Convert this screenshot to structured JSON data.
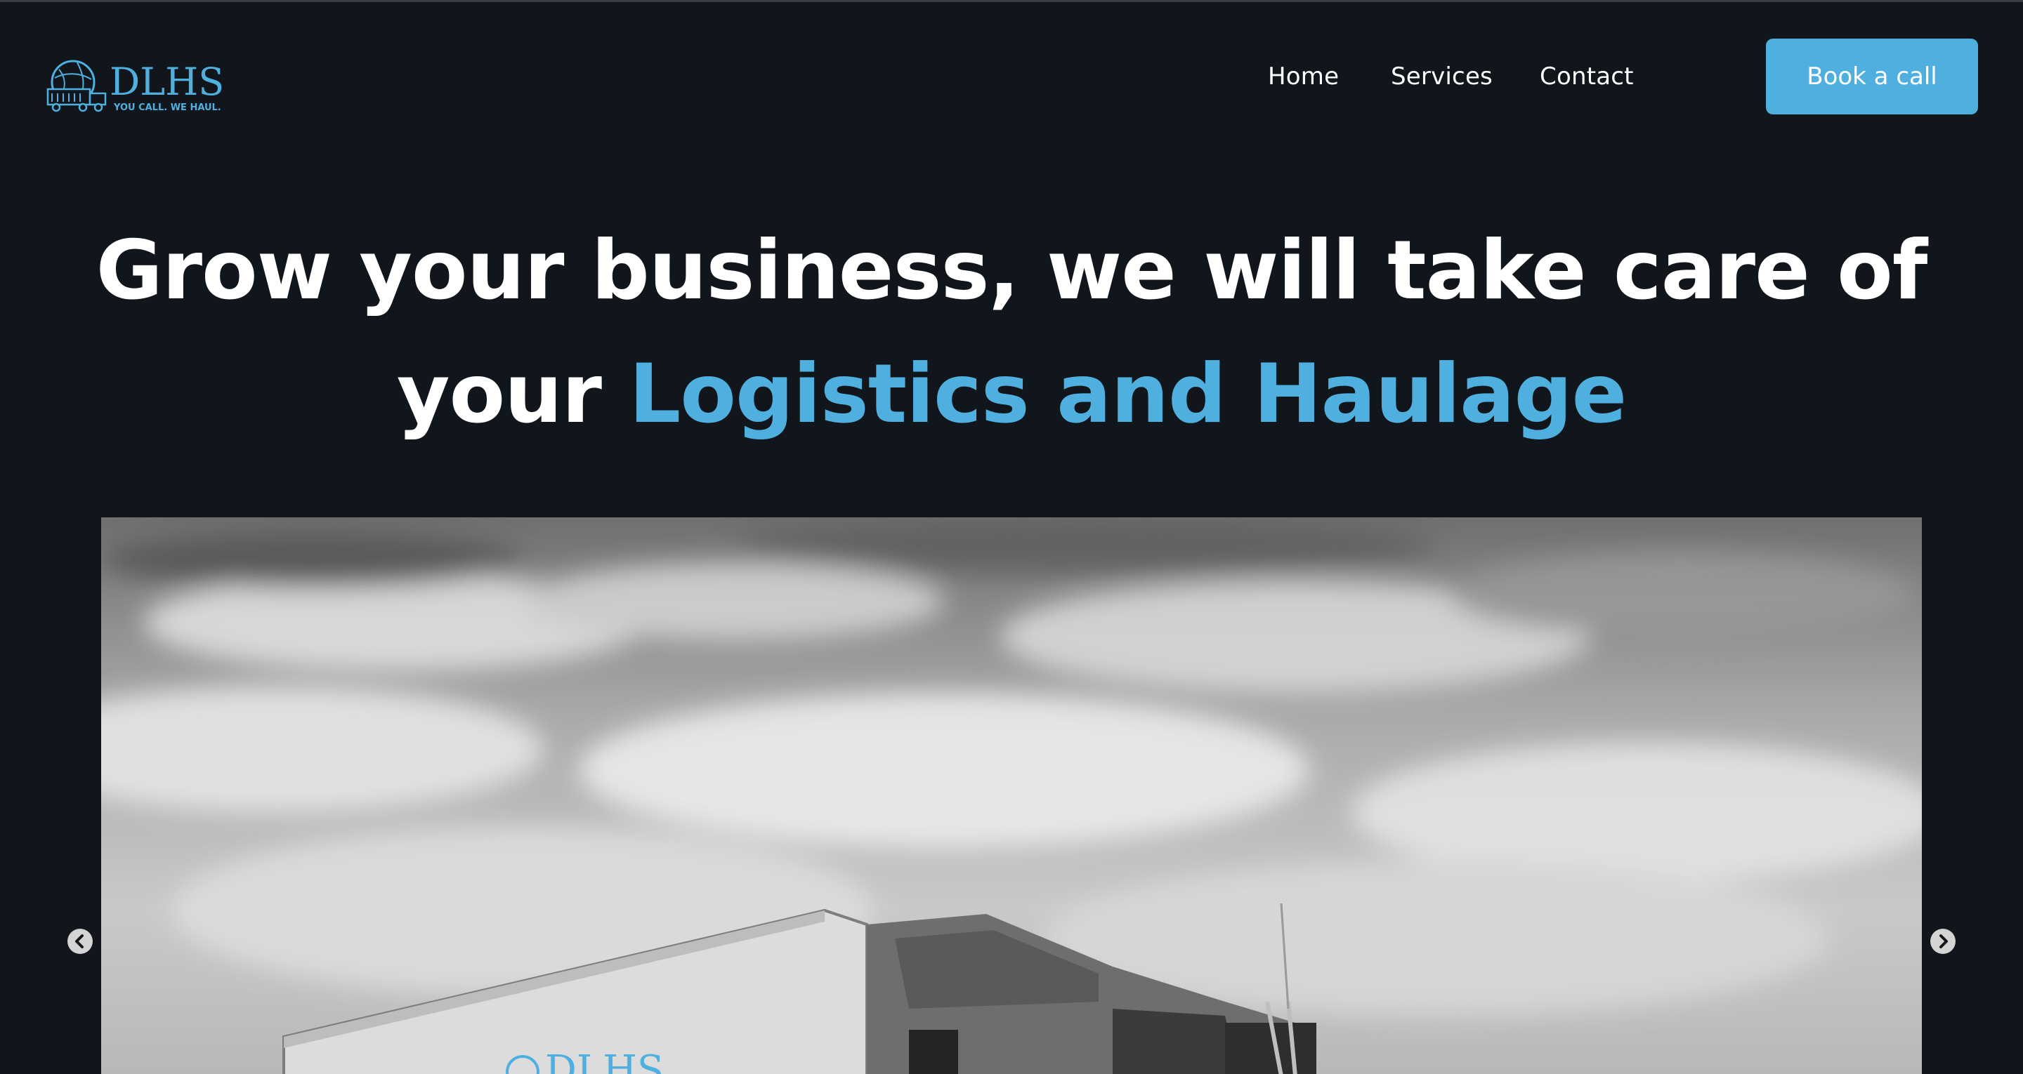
{
  "header": {
    "logo": {
      "wordmark": "DLHS",
      "tagline": "YOU CALL. WE HAUL."
    },
    "nav": [
      {
        "label": "Home"
      },
      {
        "label": "Services"
      },
      {
        "label": "Contact"
      }
    ],
    "cta_label": "Book a call"
  },
  "hero": {
    "headline_part1": "Grow your business, we will take care of",
    "headline_part2": "your ",
    "headline_accent": "Logistics and Haulage"
  },
  "slider": {
    "truck_wordmark": "DLHS",
    "prev_icon": "chevron-left-circle",
    "next_icon": "chevron-right-circle"
  },
  "colors": {
    "background": "#10161b",
    "accent": "#4fb0df",
    "text": "#ffffff"
  }
}
